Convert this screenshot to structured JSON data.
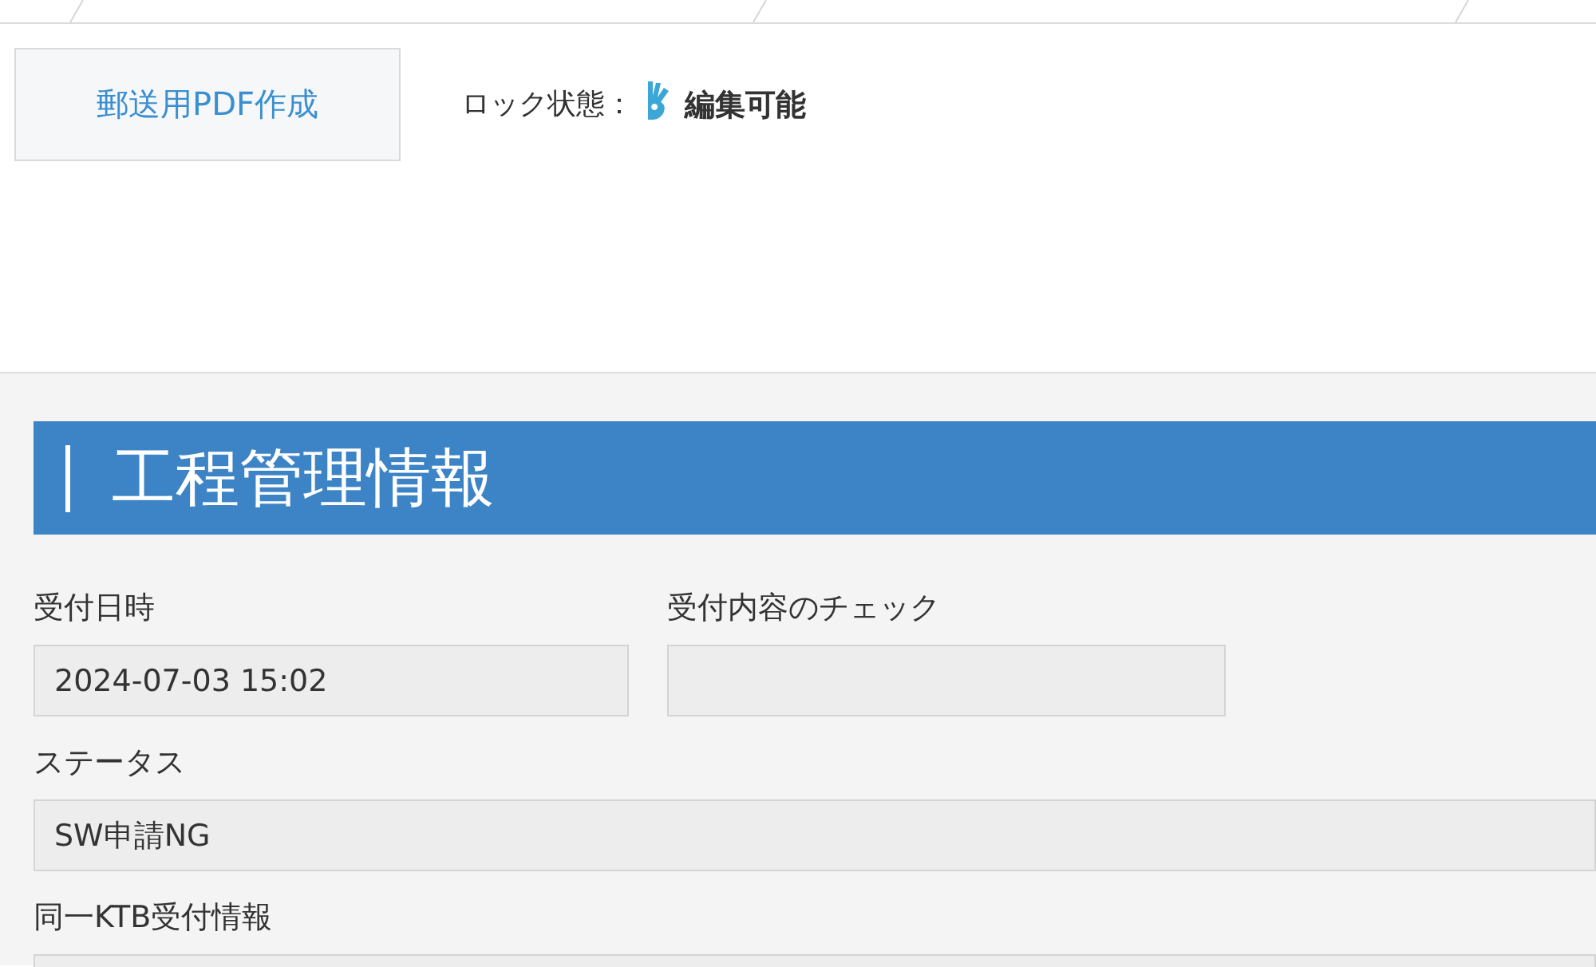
{
  "toolbar": {
    "pdf_button": "郵送用PDF作成",
    "lock_label": "ロック状態：",
    "lock_status": "編集可能"
  },
  "section": {
    "title": "工程管理情報",
    "field_rows": [
      {
        "fields": [
          {
            "label": "受付日時",
            "value": "2024-07-03 15:02",
            "kind": "half"
          },
          {
            "label": "受付内容のチェック",
            "kind": "half"
          }
        ]
      },
      {
        "fields": [
          {
            "label": "ステータス",
            "value": "SW申請NG",
            "kind": "full"
          }
        ]
      },
      {
        "fields": [
          {
            "label": "同一KTB受付情報",
            "kind": "full"
          }
        ]
      }
    ]
  }
}
